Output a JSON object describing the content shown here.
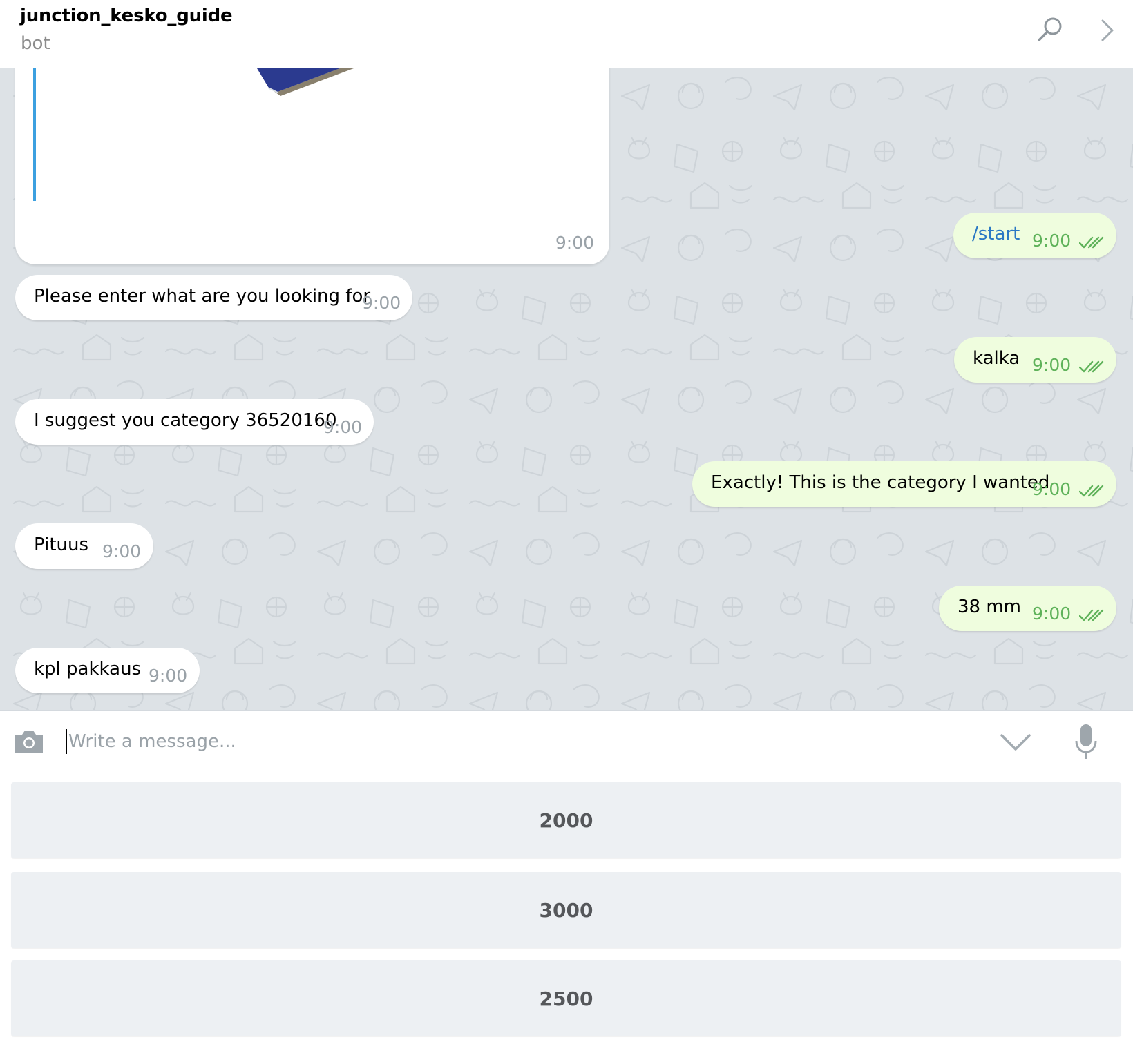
{
  "header": {
    "title": "junction_kesko_guide",
    "subtitle": "bot"
  },
  "chat": {
    "photo_message": {
      "time": "9:00"
    },
    "messages": [
      {
        "direction": "out",
        "text": "/start",
        "time": "9:00",
        "is_command": true,
        "read": true
      },
      {
        "direction": "in",
        "text": "Please enter what are you looking for",
        "time": "9:00"
      },
      {
        "direction": "out",
        "text": "kalka",
        "time": "9:00",
        "read": true
      },
      {
        "direction": "in",
        "text": "I suggest you category 36520160",
        "time": "9:00"
      },
      {
        "direction": "out",
        "text": "Exactly! This is the category I wanted",
        "time": "9:00",
        "read": true
      },
      {
        "direction": "in",
        "text": "Pituus",
        "time": "9:00"
      },
      {
        "direction": "out",
        "text": "38 mm",
        "time": "9:00",
        "read": true
      },
      {
        "direction": "in",
        "text": "kpl pakkaus",
        "time": "9:00"
      }
    ]
  },
  "composer": {
    "placeholder": "Write a message...",
    "value": ""
  },
  "keyboard": {
    "buttons": [
      "2000",
      "3000",
      "2500"
    ]
  },
  "icons": {
    "header": [
      "search-icon",
      "chevron-right-icon"
    ],
    "composer": [
      "camera-icon",
      "chevron-down-icon",
      "microphone-icon"
    ],
    "message_status": "double-check-icon"
  },
  "colors": {
    "chat_background": "#dde2e6",
    "incoming_bubble": "#ffffff",
    "outgoing_bubble": "#effdde",
    "outgoing_time": "#5fb25a",
    "command_link": "#2a78c4",
    "keyboard_button": "#edf0f3",
    "reply_bar": "#3ca0e0"
  }
}
